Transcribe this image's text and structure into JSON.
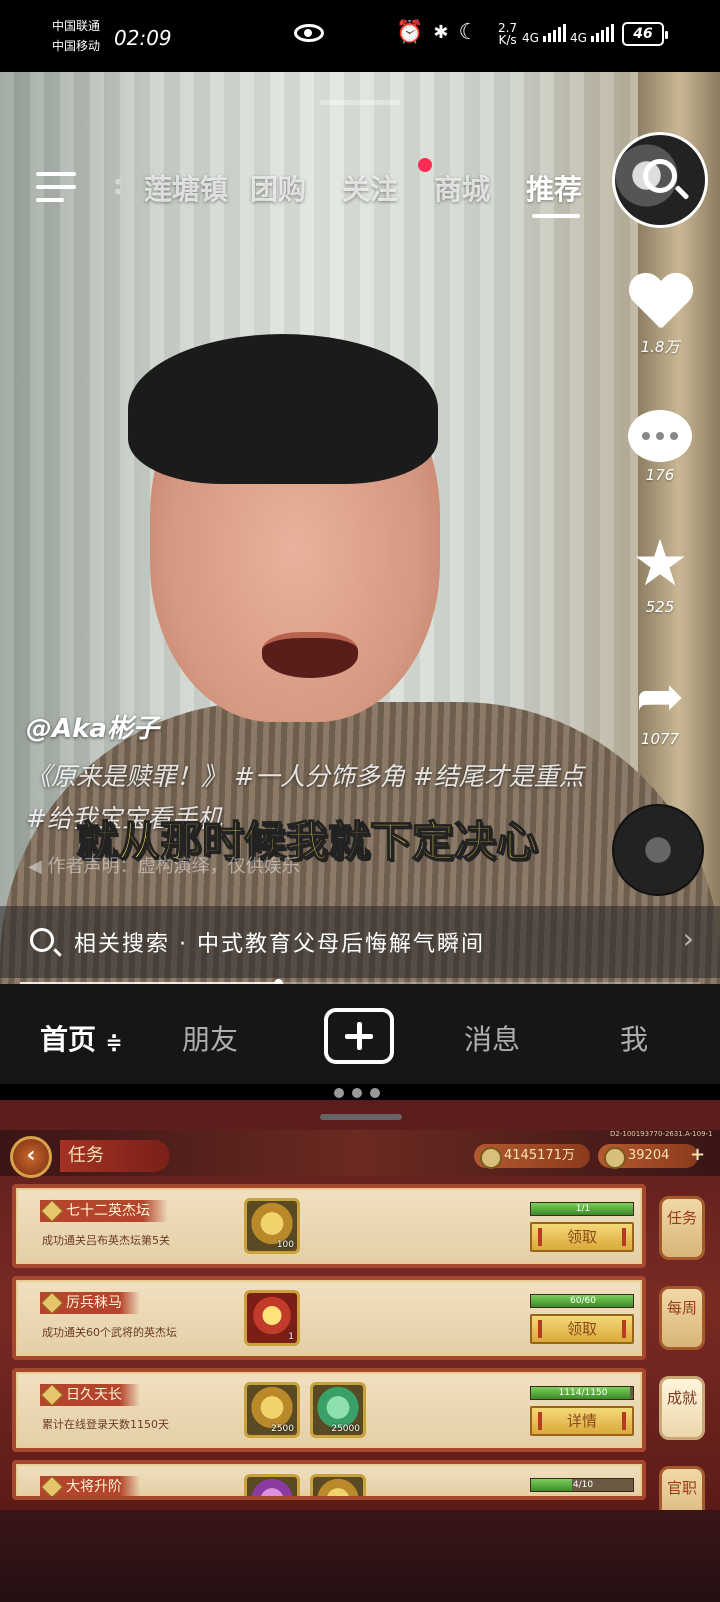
{
  "status_bar": {
    "carrier1": "中国联通",
    "carrier2": "中国移动",
    "time": "02:09",
    "net_speed_value": "2.7",
    "net_speed_unit": "K/s",
    "sig1": "4G",
    "sig2": "4G",
    "battery": "46",
    "icons": [
      "eye-icon",
      "alarm-icon",
      "bluetooth-icon",
      "vibrate-icon",
      "moon-icon"
    ]
  },
  "top_nav": {
    "tabs": [
      "莲塘镇",
      "团购",
      "关注",
      "商城",
      "推荐"
    ],
    "active_tab": "推荐"
  },
  "side_actions": {
    "likes": "1.8万",
    "comments": "176",
    "favorites": "525",
    "shares": "1077"
  },
  "video": {
    "author": "@Aka彬子",
    "description": "《原来是赎罪！》 #一人分饰多角 #结尾才是重点 #给我宝宝看手机",
    "subtitle": "就从那时候我就下定决心",
    "music_note": "作者声明：虚构演绎，仅供娱乐",
    "related_search": "相关搜索 · 中式教育父母后悔解气瞬间",
    "progress": 0.38
  },
  "bottom_nav": {
    "home": "首页",
    "home_suffix": "≑",
    "friends": "朋友",
    "messages": "消息",
    "me": "我"
  },
  "game": {
    "title": "任务",
    "currency1": "4145171万",
    "currency2": "39204",
    "account_id": "D2-100193770-2631.A-109-1",
    "tasks": [
      {
        "name": "七十二英杰坛",
        "desc": "成功通关吕布英杰坛第5关",
        "items": [
          "100"
        ],
        "progress_text": "1/1",
        "progress": 1.0,
        "button": "领取"
      },
      {
        "name": "厉兵秣马",
        "desc": "成功通关60个武将的英杰坛",
        "items": [
          "1"
        ],
        "progress_text": "60/60",
        "progress": 1.0,
        "button": "领取"
      },
      {
        "name": "日久天长",
        "desc": "累计在线登录天数1150天",
        "items": [
          "2500",
          "25000"
        ],
        "progress_text": "1114/1150",
        "progress": 0.969,
        "button": "详情"
      },
      {
        "name": "大将升阶",
        "desc": "",
        "items": [
          "",
          ""
        ],
        "progress_text": "4/10",
        "progress": 0.4,
        "button": ""
      }
    ],
    "side_tabs": [
      "任务",
      "每周",
      "成就",
      "官职"
    ],
    "selected_side_tab": "成就"
  }
}
